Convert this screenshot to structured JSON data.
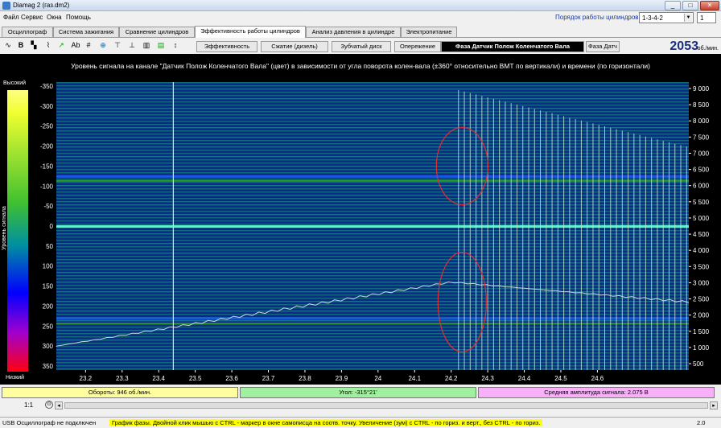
{
  "window": {
    "title": "Diamag 2 (газ.dm2)",
    "minimize": "_",
    "maximize": "□",
    "close": "✕"
  },
  "menu": [
    "Файл",
    "Сервис",
    "Окна",
    "Помощь"
  ],
  "cylinder_order": {
    "label": "Порядок работы цилиндров",
    "value": "1-3-4-2",
    "index": "1"
  },
  "tabs": [
    "Осциллограф",
    "Система зажигания",
    "Сравнение цилиндров",
    "Эффективность работы цилиндров",
    "Анализ давления в цилиндре",
    "Электропитание"
  ],
  "active_tab": 3,
  "subtabs": [
    "Эффективность",
    "Сжатие (дизель)",
    "Зубчатый диск",
    "Опережение",
    "Фаза Датчик Полож Коленчатого Вала",
    "Фаза Датч"
  ],
  "active_subtab": 4,
  "rpm": {
    "value": "2053",
    "unit": "об./мин."
  },
  "plot_heading": "Уровень сигнала на канале \"Датчик Полож Коленчатого Вала\" (цвет) в зависимости от угла поворота колен-вала (±360° относительно ВМТ по вертикали) и времени (по горизонтали)",
  "color_scale": {
    "top": "Высокий",
    "bottom": "Низкий",
    "side": "Уровень сигнала"
  },
  "status": {
    "rpm": "Обороты: 946 об./мин.",
    "angle": "Угол: -315°21'",
    "amplitude": "Средняя амплитуда сигнала: 2.075 В"
  },
  "zoom": "1:1",
  "statusbar": {
    "device": "USB Осциллограф не подключен",
    "hint": "График фазы. Двойной клик мышью с CTRL - маркер в окне самописца на соотв. точку. Увеличение (зум) с CTRL - по гориз. и верт., без CTRL - по гориз.",
    "version": "2.0"
  },
  "colors": {
    "status_rpm": "#ffffa0",
    "status_angle": "#a0f0a0",
    "status_amp": "#f8b0f8",
    "hint_bg": "#ffff00"
  },
  "chart_data": {
    "type": "heatmap",
    "xlim": [
      23.12,
      24.85
    ],
    "x_ticks": [
      "23.2",
      "23.3",
      "23.4",
      "23.5",
      "23.6",
      "23.7",
      "23.8",
      "23.9",
      "24",
      "24.1",
      "24.2",
      "24.3",
      "24.4",
      "24.5",
      "24.6"
    ],
    "ylim": [
      360,
      -360
    ],
    "y_ticks": [
      "-350",
      "-300",
      "-250",
      "-200",
      "-150",
      "-100",
      "-50",
      "0",
      "50",
      "100",
      "150",
      "200",
      "250",
      "300",
      "350"
    ],
    "y2_ticks": [
      "9 000",
      "8 500",
      "8 000",
      "7 500",
      "7 000",
      "6 500",
      "6 000",
      "5 500",
      "5 000",
      "4 500",
      "4 000",
      "3 500",
      "3 000",
      "2 500",
      "2 000",
      "1 500",
      "1 000",
      "500"
    ],
    "marker_x": 23.44
  }
}
